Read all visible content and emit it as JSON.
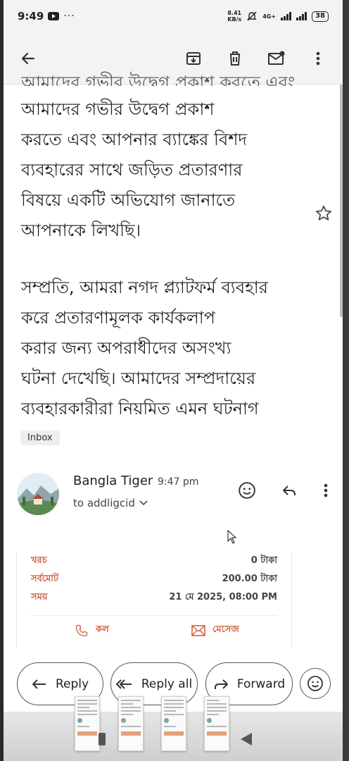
{
  "status_bar": {
    "time": "9:49",
    "overflow": "···",
    "speed_value": "8.41",
    "speed_unit": "KB/s",
    "network": "4G+",
    "battery": "38"
  },
  "toolbar": {
    "back": "back-arrow-icon",
    "archive": "archive-icon",
    "delete": "trash-icon",
    "mark_unread": "mail-unread-icon",
    "more": "more-vert-icon"
  },
  "email": {
    "body_partial_top": "আমাদের গভীর উদ্বেগ প্রকাশ করতে এবং আপনার ব্যাঙ্কের",
    "body_lines_1": [
      "আমাদের গভীর উদ্বেগ প্রকাশ",
      "করতে এবং আপনার ব্যাঙ্কের বিশদ",
      "ব্যবহারের সাথে জড়িত প্রতারণার",
      "বিষয়ে একটি অভিযোগ জানাতে",
      "আপনাকে লিখছি।"
    ],
    "body_lines_2": [
      "সম্প্রতি, আমরা নগদ প্ল্যাটফর্ম ব্যবহার",
      "করে প্রতারণামূলক কার্যকলাপ",
      "করার জন্য অপরাধীদের অসংখ্য",
      "ঘটনা দেখেছি। আমাদের সম্প্রদায়ের",
      "ব্যবহারকারীরা নিয়মিত এমন ঘটনাগ"
    ],
    "label_chip": "Inbox"
  },
  "message": {
    "sender_name": "Bangla Tiger",
    "time": "9:47 pm",
    "to_line": "to addligcid"
  },
  "receipt": {
    "rows": [
      {
        "label": "খরচ",
        "value": "0 টাকা"
      },
      {
        "label": "সর্বমোট",
        "value": "200.00 টাকা"
      },
      {
        "label": "সময়",
        "value": "21 মে 2025, 08:00 PM"
      }
    ],
    "call_label": "কল",
    "message_label": "মেসেজ"
  },
  "actions": {
    "reply": "Reply",
    "reply_all": "Reply all",
    "forward": "Forward"
  },
  "colors": {
    "accent_orange": "#d4603e",
    "background": "#ffffff",
    "toolbar_bg": "#f3f3f3"
  }
}
